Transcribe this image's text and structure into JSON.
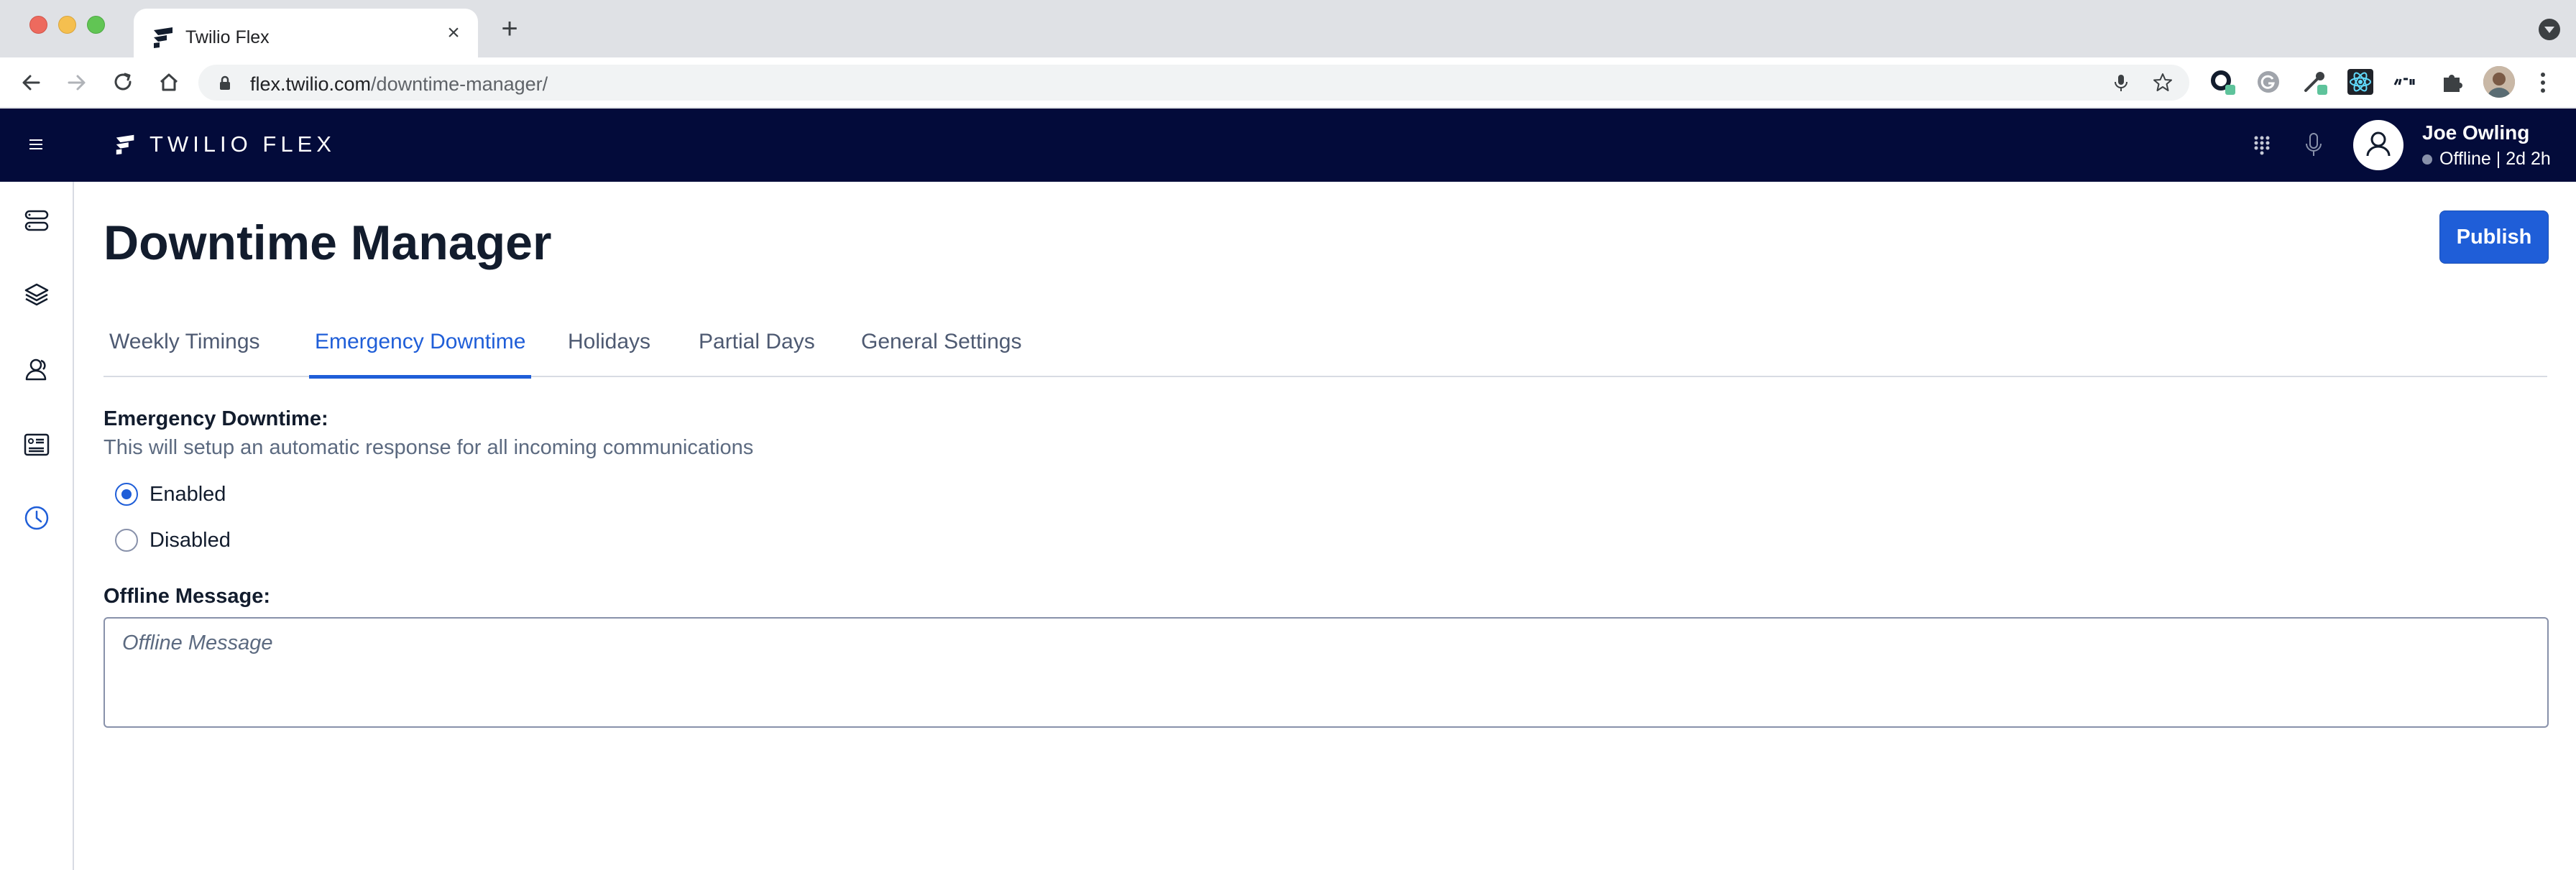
{
  "browser": {
    "tab_title": "Twilio Flex",
    "new_tab_icon": "plus-icon",
    "close_icon": "close-icon",
    "url_host": "flex.twilio.com",
    "url_path": "/downtime-manager/"
  },
  "header": {
    "brand": "TWILIO FLEX",
    "user_name": "Joe Owling",
    "user_status": "Offline | 2d 2h",
    "bg_color": "#030b3a"
  },
  "sidebar": {
    "items": [
      {
        "icon": "agents-desktop-icon"
      },
      {
        "icon": "layers-icon"
      },
      {
        "icon": "teams-icon"
      },
      {
        "icon": "queues-stats-icon"
      },
      {
        "icon": "clock-icon",
        "active": true
      }
    ]
  },
  "main": {
    "title": "Downtime Manager",
    "publish_label": "Publish",
    "tabs": [
      {
        "label": "Weekly Timings"
      },
      {
        "label": "Emergency Downtime",
        "active": true
      },
      {
        "label": "Holidays"
      },
      {
        "label": "Partial Days"
      },
      {
        "label": "General Settings"
      }
    ],
    "emergency": {
      "label": "Emergency Downtime:",
      "help": "This will setup an automatic response for all incoming communications",
      "options": [
        {
          "label": "Enabled",
          "checked": true
        },
        {
          "label": "Disabled",
          "checked": false
        }
      ]
    },
    "offline_message": {
      "label": "Offline Message:",
      "placeholder": "Offline Message",
      "value": ""
    }
  },
  "colors": {
    "accent": "#1f5ed8",
    "text": "#121c2d",
    "muted": "#5c6a80"
  }
}
